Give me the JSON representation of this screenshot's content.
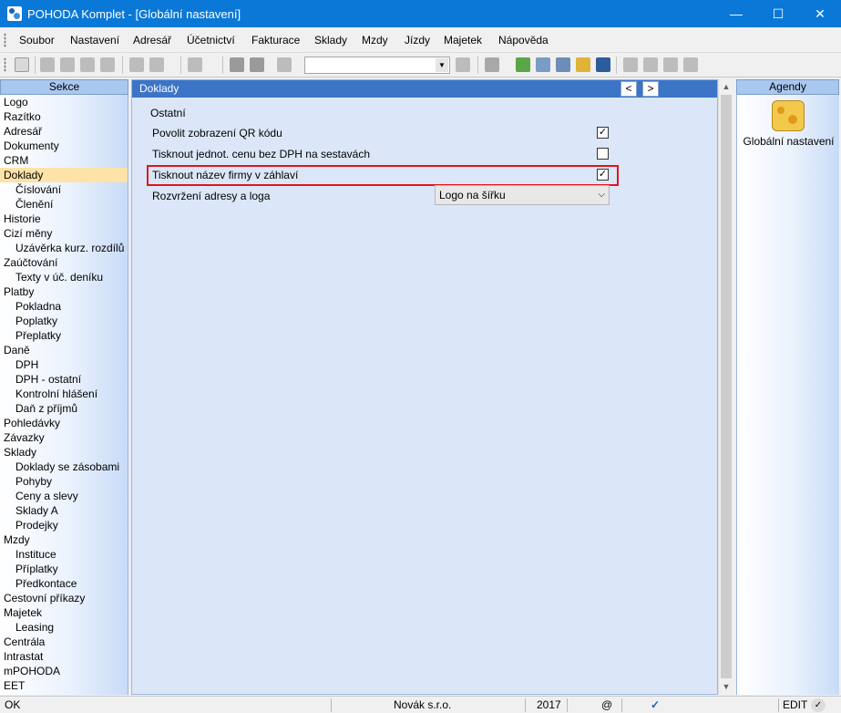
{
  "window": {
    "title": "POHODA Komplet - [Globální nastavení]",
    "minimize": "—",
    "maximize": "☐",
    "close": "✕"
  },
  "menu": {
    "items": [
      "Soubor",
      "Nastavení",
      "Adresář",
      "Účetnictví",
      "Fakturace",
      "Sklady",
      "Mzdy",
      "Jízdy",
      "Majetek",
      "Nápověda"
    ]
  },
  "sidebar": {
    "header": "Sekce",
    "selected": "Doklady",
    "items": [
      {
        "label": "Logo",
        "level": 0
      },
      {
        "label": "Razítko",
        "level": 0
      },
      {
        "label": "Adresář",
        "level": 0
      },
      {
        "label": "Dokumenty",
        "level": 0
      },
      {
        "label": "CRM",
        "level": 0
      },
      {
        "label": "Doklady",
        "level": 0
      },
      {
        "label": "Číslování",
        "level": 1
      },
      {
        "label": "Členění",
        "level": 1
      },
      {
        "label": "Historie",
        "level": 0
      },
      {
        "label": "Cizí měny",
        "level": 0
      },
      {
        "label": "Uzávěrka kurz. rozdílů",
        "level": 1
      },
      {
        "label": "Zaúčtování",
        "level": 0
      },
      {
        "label": "Texty v úč. deníku",
        "level": 1
      },
      {
        "label": "Platby",
        "level": 0
      },
      {
        "label": "Pokladna",
        "level": 1
      },
      {
        "label": "Poplatky",
        "level": 1
      },
      {
        "label": "Přeplatky",
        "level": 1
      },
      {
        "label": "Daně",
        "level": 0
      },
      {
        "label": "DPH",
        "level": 1
      },
      {
        "label": "DPH - ostatní",
        "level": 1
      },
      {
        "label": "Kontrolní hlášení",
        "level": 1
      },
      {
        "label": "Daň z příjmů",
        "level": 1
      },
      {
        "label": "Pohledávky",
        "level": 0
      },
      {
        "label": "Závazky",
        "level": 0
      },
      {
        "label": "Sklady",
        "level": 0
      },
      {
        "label": "Doklady se zásobami",
        "level": 1
      },
      {
        "label": "Pohyby",
        "level": 1
      },
      {
        "label": "Ceny a slevy",
        "level": 1
      },
      {
        "label": "Sklady A",
        "level": 1
      },
      {
        "label": "Prodejky",
        "level": 1
      },
      {
        "label": "Mzdy",
        "level": 0
      },
      {
        "label": "Instituce",
        "level": 1
      },
      {
        "label": "Příplatky",
        "level": 1
      },
      {
        "label": "Předkontace",
        "level": 1
      },
      {
        "label": "Cestovní příkazy",
        "level": 0
      },
      {
        "label": "Majetek",
        "level": 0
      },
      {
        "label": "Leasing",
        "level": 1
      },
      {
        "label": "Centrála",
        "level": 0
      },
      {
        "label": "Intrastat",
        "level": 0
      },
      {
        "label": "mPOHODA",
        "level": 0
      },
      {
        "label": "EET",
        "level": 0
      }
    ]
  },
  "content": {
    "header": "Doklady",
    "nav_prev": "<",
    "nav_next": ">",
    "group_title": "Ostatní",
    "options": [
      {
        "label": "Povolit zobrazení QR kódu",
        "checked": true
      },
      {
        "label": "Tisknout jednot. cenu bez DPH na sestavách",
        "checked": false
      },
      {
        "label": "Tisknout název firmy v záhlaví",
        "checked": true,
        "highlighted": true
      }
    ],
    "layout_label": "Rozvržení adresy a loga",
    "layout_value": "Logo na šířku"
  },
  "agenda": {
    "header": "Agendy",
    "item_label": "Globální nastavení",
    "item_icon": "settings-cheese-icon"
  },
  "statusbar": {
    "status": "OK",
    "company": "Novák s.r.o.",
    "year": "2017",
    "at_symbol": "@",
    "mode": "EDIT"
  },
  "colors": {
    "titlebar": "#0a78d7",
    "content_header": "#3c74c8",
    "selected_item": "#fde3a8",
    "highlight_border": "#e2141b"
  }
}
